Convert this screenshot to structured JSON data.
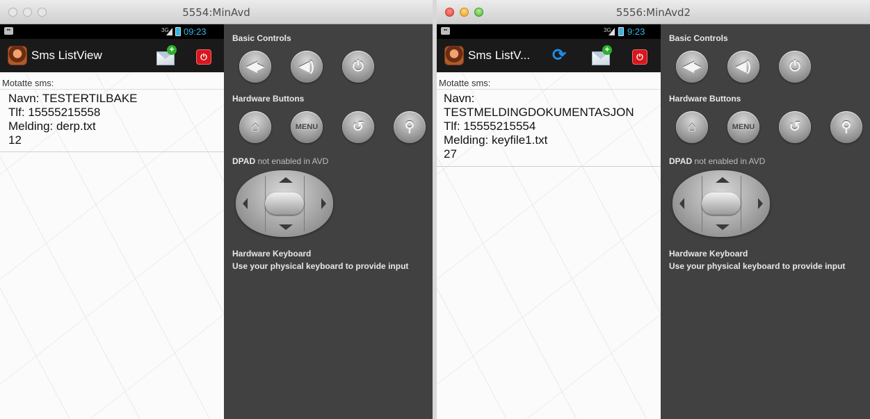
{
  "windows": [
    {
      "title": "5554:MinAvd",
      "status_time": "09:23",
      "app_title": "Sms ListView",
      "list_header": "Motatte sms:",
      "sms": [
        {
          "name_line": "Navn: TESTERTILBAKE",
          "phone_line": "Tlf: 15555215558",
          "message_line": "Melding: derp.txt",
          "count_line": "12"
        }
      ],
      "controls": {
        "basic_label": "Basic Controls",
        "hardware_label": "Hardware Buttons",
        "menu_label": "MENU",
        "dpad_label": "DPAD",
        "dpad_note": "not enabled in AVD",
        "keyboard_label": "Hardware Keyboard",
        "keyboard_hint": "Use your physical keyboard to provide input"
      }
    },
    {
      "title": "5556:MinAvd2",
      "status_time": "9:23",
      "app_title": "Sms ListV...",
      "list_header": "Motatte sms:",
      "sms": [
        {
          "name_line": "Navn:",
          "name_value": "TESTMELDINGDOKUMENTASJON",
          "phone_line": "Tlf: 15555215554",
          "message_line": "Melding: keyfile1.txt",
          "count_line": "27"
        }
      ],
      "controls": {
        "basic_label": "Basic Controls",
        "hardware_label": "Hardware Buttons",
        "menu_label": "MENU",
        "dpad_label": "DPAD",
        "dpad_note": "not enabled in AVD",
        "keyboard_label": "Hardware Keyboard",
        "keyboard_hint": "Use your physical keyboard to provide input"
      }
    }
  ],
  "icons": {
    "notification": "notification-icon",
    "signal": "signal-icon",
    "battery": "battery-icon",
    "compose": "compose-sms-icon",
    "power": "power-icon",
    "refresh": "refresh-icon",
    "volume_down": "volume-down-icon",
    "volume_up": "volume-up-icon",
    "device_power": "device-power-icon",
    "home": "home-icon",
    "back": "back-icon",
    "search": "search-icon"
  },
  "colors": {
    "status_time": "#33b5e5",
    "controls_bg": "#414141",
    "action_bar": "#1a1a1a",
    "power_red": "#d9161d",
    "refresh_blue": "#1e8ee8"
  }
}
